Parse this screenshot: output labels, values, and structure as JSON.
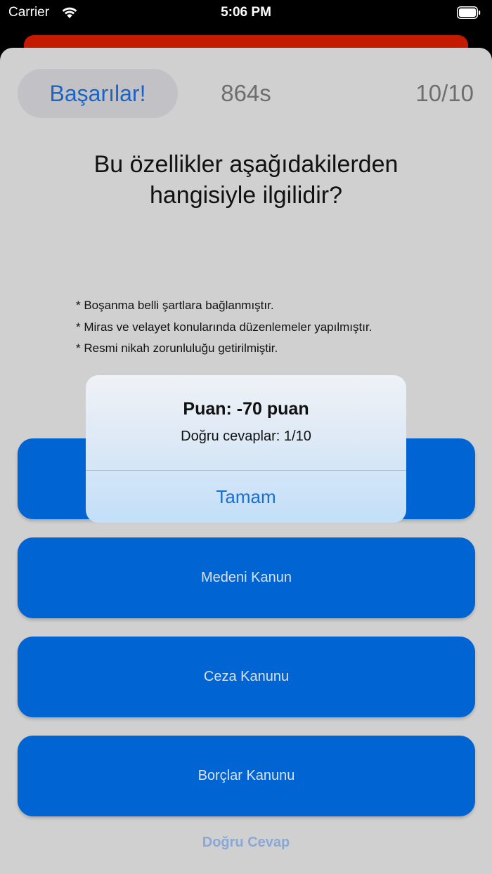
{
  "status_bar": {
    "carrier": "Carrier",
    "time": "5:06 PM"
  },
  "quiz": {
    "achievements_label": "Başarılar!",
    "timer": "864s",
    "progress": "10/10",
    "question": "Bu özellikler aşağıdakilerden hangisiyle ilgilidir?",
    "facts": [
      "* Boşanma belli şartlara bağlanmıştır.",
      "* Miras ve velayet konularında düzenlemeler yapılmıştır.",
      "* Resmi nikah zorunluluğu getirilmiştir."
    ],
    "answers": [
      "",
      "Medeni Kanun",
      "Ceza Kanunu",
      "Borçlar Kanunu"
    ],
    "correct_answer_label": "Doğru Cevap"
  },
  "alert": {
    "title": "Puan: -70 puan",
    "message": "Doğru cevaplar: 1/10",
    "ok_label": "Tamam"
  },
  "colors": {
    "answer_button": "#0064d2",
    "accent_blue": "#1b64c4",
    "behind_card_red": "#c31a00",
    "sheet_background": "#d0d0d0"
  }
}
